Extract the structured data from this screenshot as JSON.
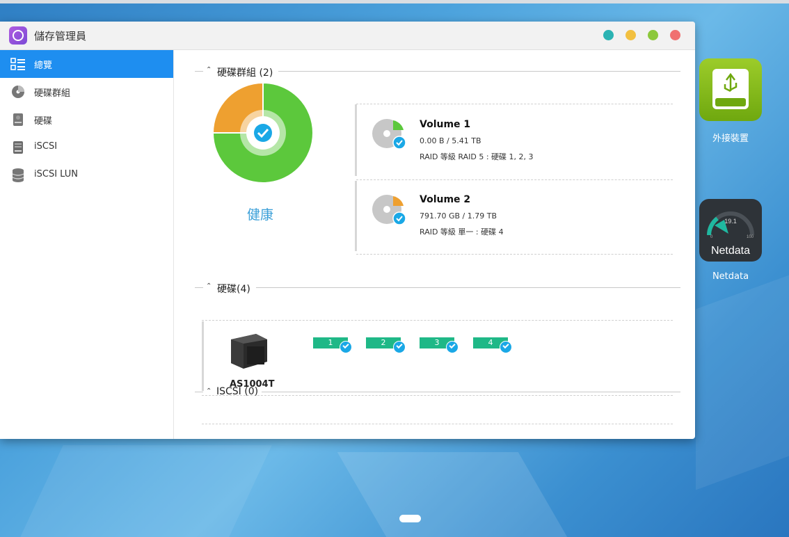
{
  "app": {
    "title": "儲存管理員"
  },
  "window_controls": [
    {
      "name": "minimize-dot",
      "color": "#2bb3b3"
    },
    {
      "name": "restore-dot",
      "color": "#f2c040"
    },
    {
      "name": "maximize-dot",
      "color": "#8cc83c"
    },
    {
      "name": "close-dot",
      "color": "#f07070"
    }
  ],
  "sidebar": {
    "items": [
      {
        "label": "總覽",
        "icon": "overview-list-icon",
        "active": true
      },
      {
        "label": "硬碟群組",
        "icon": "disk-group-icon",
        "active": false
      },
      {
        "label": "硬碟",
        "icon": "hard-disk-icon",
        "active": false
      },
      {
        "label": "iSCSI",
        "icon": "iscsi-icon",
        "active": false
      },
      {
        "label": "iSCSI LUN",
        "icon": "iscsi-lun-database-icon",
        "active": false
      }
    ]
  },
  "volume_group": {
    "header": "硬碟群組 (2)",
    "status": "健康",
    "chart_data": {
      "type": "pie",
      "slices": [
        {
          "name": "green",
          "value": 75,
          "color": "#5cc83c"
        },
        {
          "name": "orange",
          "value": 25,
          "color": "#eea030"
        }
      ]
    },
    "volumes": [
      {
        "name": "Volume 1",
        "usage": "0.00 B / 5.41 TB",
        "raid": "RAID 等級 RAID 5 : 硬碟 1, 2, 3",
        "accent": "#5cc83c"
      },
      {
        "name": "Volume 2",
        "usage": "791.70 GB / 1.79 TB",
        "raid": "RAID 等級 單一 : 硬碟 4",
        "accent": "#eea030"
      }
    ]
  },
  "disks": {
    "header": "硬碟(4)",
    "device": "AS1004T",
    "slots": [
      "1",
      "2",
      "3",
      "4"
    ]
  },
  "iscsi": {
    "header": "ISCSI (0)"
  },
  "desktop": {
    "external": {
      "label": "外接裝置"
    },
    "netdata": {
      "label": "Netdata",
      "title": "Netdata",
      "gauge": "19.1",
      "min": "0",
      "max": "100"
    }
  }
}
